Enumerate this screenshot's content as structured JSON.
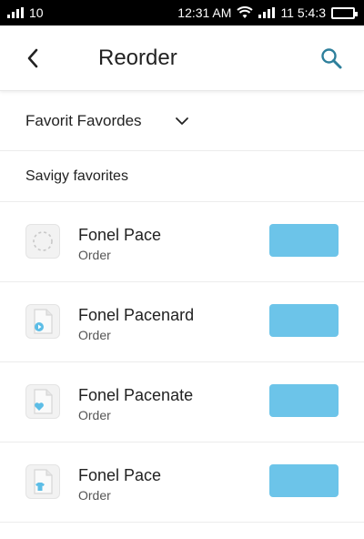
{
  "status_bar": {
    "left_text": "10",
    "time": "12:31 AM",
    "right_text": "11 5:4:3",
    "battery_color": "#5cd64c"
  },
  "header": {
    "title": "Reorder",
    "back_icon": "chevron-left-icon",
    "search_icon": "search-icon",
    "accent_color": "#2d7f9b"
  },
  "dropdown": {
    "label": "Favorit Favordes",
    "icon": "chevron-down-icon"
  },
  "section": {
    "label": "Savigy favorites"
  },
  "items": [
    {
      "title": "Fonel Pace",
      "subtitle": "Order",
      "thumb_icon": "placeholder-circle-icon"
    },
    {
      "title": "Fonel Pacenard",
      "subtitle": "Order",
      "thumb_icon": "document-play-icon"
    },
    {
      "title": "Fonel Pacenate",
      "subtitle": "Order",
      "thumb_icon": "document-heart-icon"
    },
    {
      "title": "Fonel Pace",
      "subtitle": "Order",
      "thumb_icon": "document-shirt-icon"
    }
  ],
  "action_button_color": "#6cc4e9"
}
